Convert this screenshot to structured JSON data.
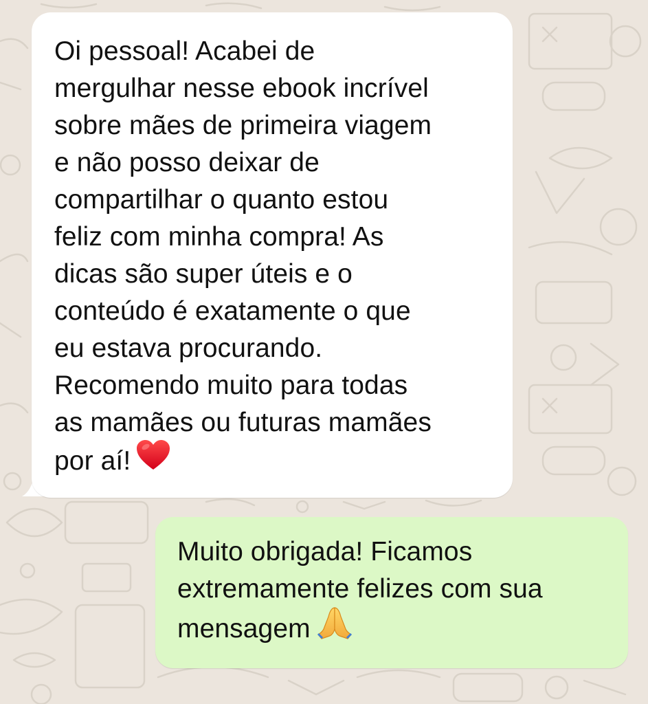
{
  "chat": {
    "wallpaper_color": "#ece5dd",
    "incoming": {
      "bubble_color": "#ffffff",
      "lines": [
        "Oi pessoal! Acabei de",
        "mergulhar nesse ebook incrível",
        "sobre mães de primeira viagem",
        "e não posso deixar de",
        "compartilhar o quanto estou",
        "feliz com minha compra! As",
        "dicas são super úteis e o",
        "conteúdo é exatamente o que",
        "eu estava procurando.",
        "Recomendo muito para todas",
        "as mamães ou futuras mamães",
        "por aí!"
      ],
      "emoji": "heart-icon"
    },
    "outgoing": {
      "bubble_color": "#dcf8c6",
      "lines": [
        "Muito obrigada! Ficamos",
        "extremamente felizes com sua",
        "mensagem"
      ],
      "emoji": "folded-hands-icon"
    }
  }
}
